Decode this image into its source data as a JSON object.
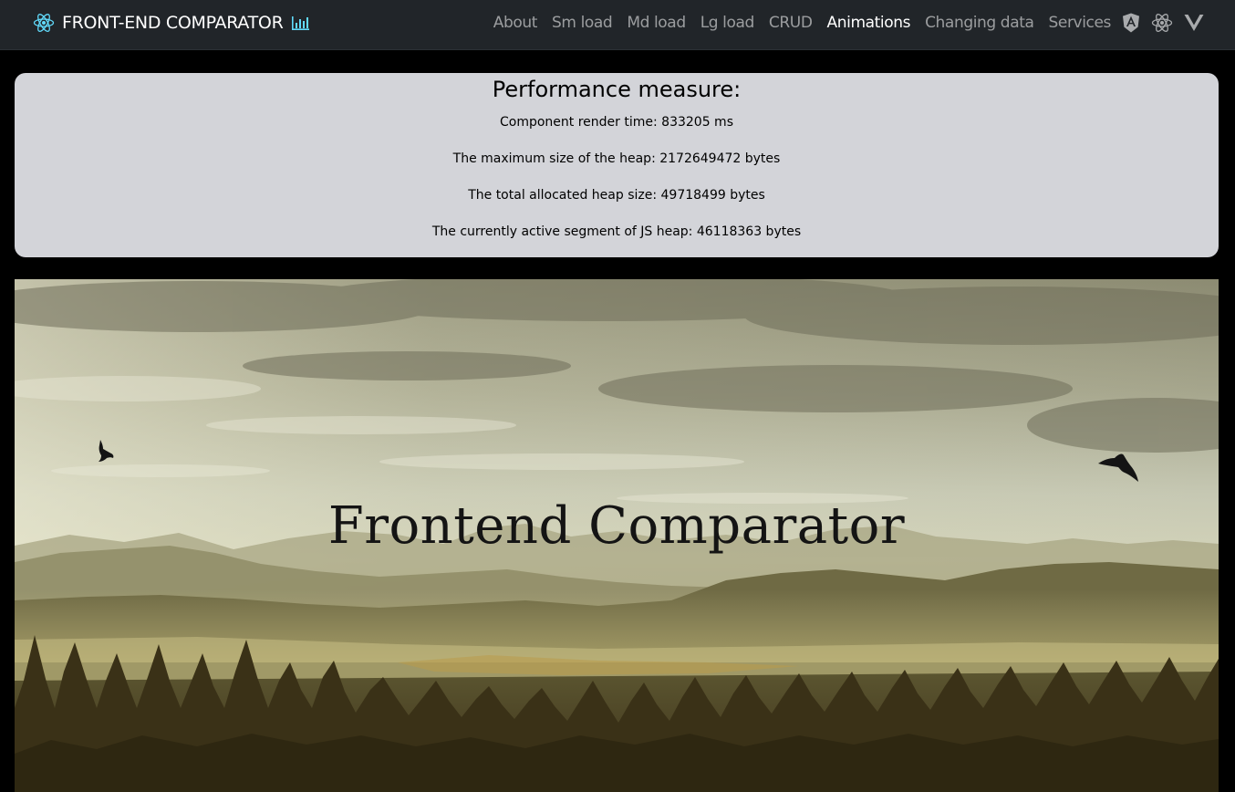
{
  "navbar": {
    "brand_text": "FRONT-END COMPARATOR",
    "brand_left_icon": "react-icon",
    "brand_right_icon": "bar-chart-icon",
    "links": [
      {
        "label": "About",
        "active": false
      },
      {
        "label": "Sm load",
        "active": false
      },
      {
        "label": "Md load",
        "active": false
      },
      {
        "label": "Lg load",
        "active": false
      },
      {
        "label": "CRUD",
        "active": false
      },
      {
        "label": "Animations",
        "active": true
      },
      {
        "label": "Changing data",
        "active": false
      },
      {
        "label": "Services",
        "active": false
      }
    ],
    "framework_icons": [
      "angular-icon",
      "react-icon",
      "vue-icon"
    ]
  },
  "performance": {
    "title": "Performance measure:",
    "render_time": "Component render time: 833205 ms",
    "heap_max": "The maximum size of the heap: 2172649472 bytes",
    "heap_total": "The total allocated heap size: 49718499 bytes",
    "heap_used": "The currently active segment of JS heap: 46118363 bytes"
  },
  "hero": {
    "title": "Frontend Comparator",
    "image": "misty-forest-landscape",
    "birds": [
      "bird-icon",
      "bird-icon"
    ]
  },
  "colors": {
    "navbar_bg": "#212529",
    "page_bg": "#000000",
    "card_bg": "#d3d4d9",
    "accent_icon": "#61dafb"
  }
}
